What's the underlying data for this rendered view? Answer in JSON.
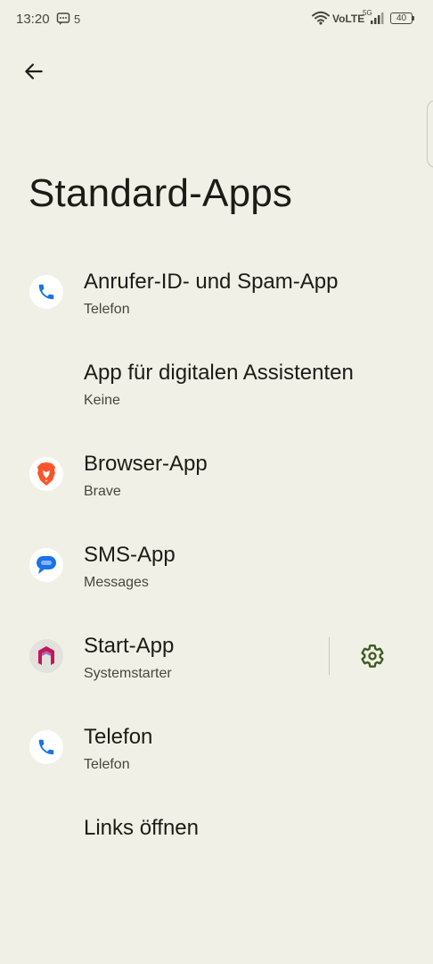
{
  "status_bar": {
    "time": "13:20",
    "notification_count": "5",
    "network": "VoLTE",
    "network_type": "5G",
    "battery": "40"
  },
  "page": {
    "title": "Standard-Apps"
  },
  "items": [
    {
      "title": "Anrufer-ID- und Spam-App",
      "subtitle": "Telefon",
      "icon": "phone-icon"
    },
    {
      "title": "App für digitalen Assistenten",
      "subtitle": "Keine",
      "icon": ""
    },
    {
      "title": "Browser-App",
      "subtitle": "Brave",
      "icon": "brave-icon"
    },
    {
      "title": "SMS-App",
      "subtitle": "Messages",
      "icon": "messages-icon"
    },
    {
      "title": "Start-App",
      "subtitle": "Systemstarter",
      "icon": "launcher-icon"
    },
    {
      "title": "Telefon",
      "subtitle": "Telefon",
      "icon": "phone-icon"
    },
    {
      "title": "Links öffnen",
      "subtitle": "",
      "icon": ""
    }
  ],
  "colors": {
    "background": "#f1f0e6",
    "text_primary": "#1b1c17",
    "text_secondary": "#45473f",
    "gear": "#3e5a1e",
    "phone_blue": "#1a73e8",
    "brave_orange": "#fb542b",
    "launcher_red": "#c2185b"
  }
}
